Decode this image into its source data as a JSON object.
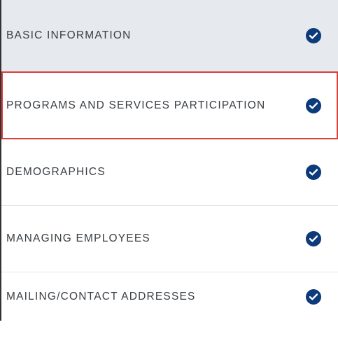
{
  "navigation": {
    "items": [
      {
        "label": "BASIC INFORMATION",
        "status_icon": "check-circle-icon",
        "completed": true
      },
      {
        "label": "PROGRAMS AND SERVICES PARTICIPATION",
        "status_icon": "check-circle-icon",
        "completed": true,
        "selected": true
      },
      {
        "label": "DEMOGRAPHICS",
        "status_icon": "check-circle-icon",
        "completed": true
      },
      {
        "label": "MANAGING EMPLOYEES",
        "status_icon": "check-circle-icon",
        "completed": true
      },
      {
        "label": "MAILING/CONTACT ADDRESSES",
        "status_icon": "check-circle-icon",
        "completed": true
      }
    ]
  },
  "colors": {
    "active_background": "#e6e9ee",
    "selected_outline": "#d9403a",
    "check_fill": "#0d3a7a",
    "label_text": "#3a3f44"
  }
}
